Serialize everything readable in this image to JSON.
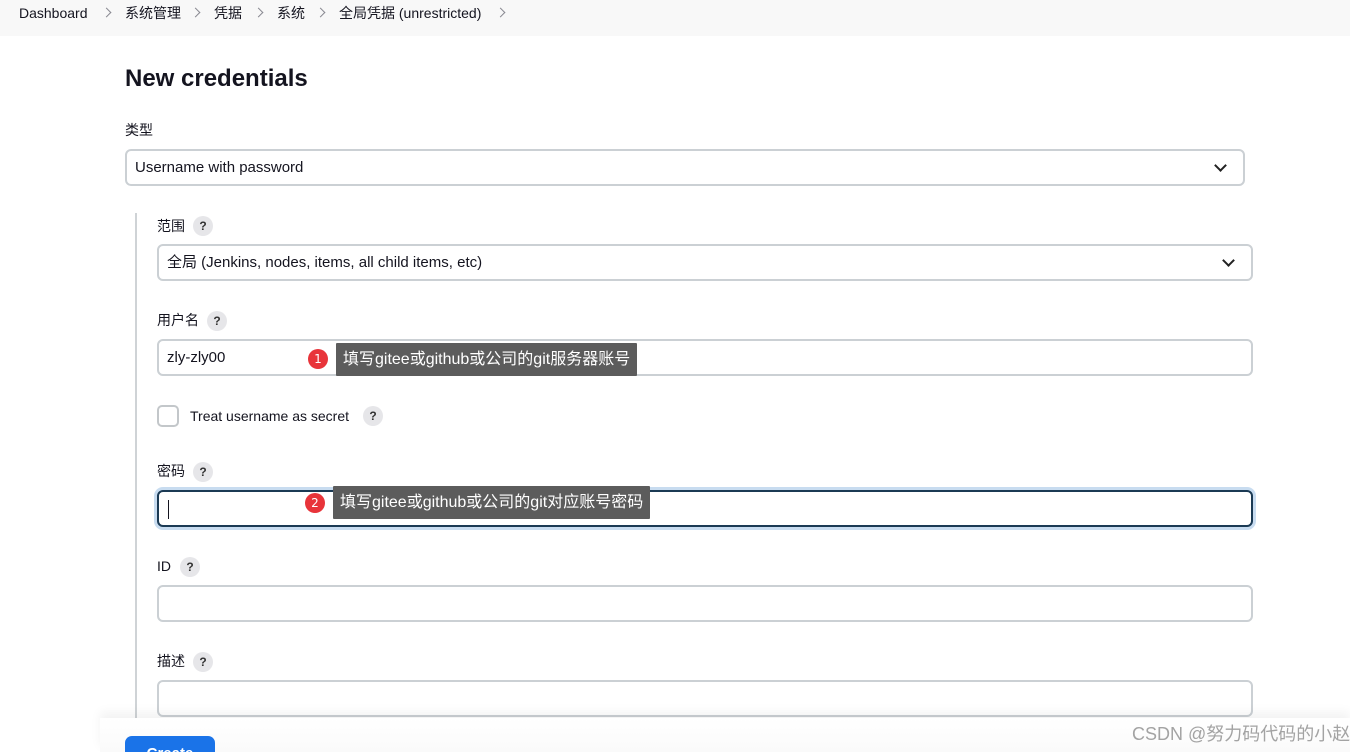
{
  "breadcrumb": [
    "Dashboard",
    "系统管理",
    "凭据",
    "系统",
    "全局凭据 (unrestricted)"
  ],
  "page_title": "New credentials",
  "kind": {
    "label": "类型",
    "selected": "Username with password"
  },
  "scope": {
    "label": "范围",
    "help": "?",
    "selected": "全局 (Jenkins, nodes, items, all child items, etc)"
  },
  "username": {
    "label": "用户名",
    "help": "?",
    "value": "zly-zly00"
  },
  "username_secret": {
    "label": "Treat username as secret",
    "help": "?",
    "checked": false
  },
  "password": {
    "label": "密码",
    "help": "?",
    "value": ""
  },
  "id": {
    "label": "ID",
    "help": "?",
    "value": ""
  },
  "description": {
    "label": "描述",
    "help": "?",
    "value": ""
  },
  "create_button": {
    "label": "Create"
  },
  "annotations": [
    {
      "number": "1",
      "text": "填写gitee或github或公司的git服务器账号"
    },
    {
      "number": "2",
      "text": "填写gitee或github或公司的git对应账号密码"
    }
  ],
  "watermark": "CSDN @努力码代码的小赵",
  "colors": {
    "accent": "#1a73e8",
    "annotation_badge": "#e8343a",
    "annotation_box": "#5c5c5c",
    "focus_border": "#1b3a54"
  }
}
